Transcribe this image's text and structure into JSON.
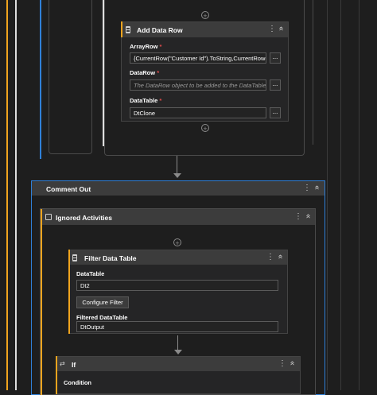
{
  "add_data_row": {
    "title": "Add Data Row",
    "icon": "table-row-icon",
    "array_row_label": "ArrayRow",
    "array_row_value": "{CurrentRow(\"Customer Id\").ToString,CurrentRow(",
    "data_row_label": "DataRow",
    "data_row_placeholder": "The DataRow object to be added to the DataTable.",
    "data_table_label": "DataTable",
    "data_table_value": "DtClone",
    "required_marker": "*",
    "browse_label": "..."
  },
  "comment_out": {
    "title": "Comment Out"
  },
  "ignored_activities": {
    "title": "Ignored Activities",
    "icon": "ignore-icon"
  },
  "filter_data_table": {
    "title": "Filter Data Table",
    "icon": "table-filter-icon",
    "data_table_label": "DataTable",
    "data_table_value": "Dt2",
    "configure_button": "Configure Filter",
    "filtered_label": "Filtered DataTable",
    "filtered_value": "DtOutput"
  },
  "if_activity": {
    "title": "If",
    "icon": "if-icon",
    "condition_label": "Condition"
  },
  "icons": {
    "kebab": "⋮",
    "collapse": "«",
    "plus": "+"
  },
  "colors": {
    "canvas": "#1e1e1e",
    "activity_header": "#3c3c3c",
    "activity_body": "#252526",
    "selected_accent": "#f0a41e",
    "blue_accent": "#2f80d8",
    "container_border": "#2f80d8"
  }
}
